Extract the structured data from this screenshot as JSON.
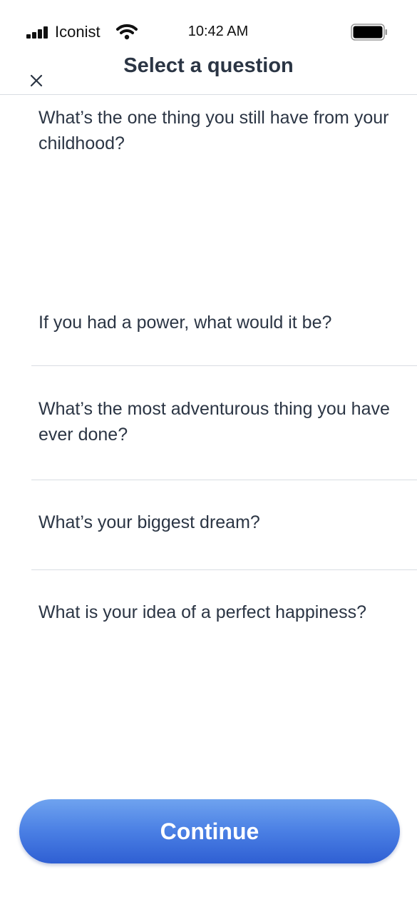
{
  "status_bar": {
    "carrier": "Iconist",
    "time": "10:42 AM",
    "signal_icon": "cellular-signal-icon",
    "wifi_icon": "wifi-icon",
    "battery_icon": "battery-icon"
  },
  "header": {
    "title": "Select a question",
    "close_icon": "close-icon"
  },
  "questions": [
    {
      "text": "What’s the one thing you still have from your childhood?"
    },
    {
      "text": "If you had a power, what would it be?"
    },
    {
      "text": "What’s the most adventurous thing you have ever done?"
    },
    {
      "text": "What’s your biggest dream?"
    },
    {
      "text": "What is your idea of a perfect happiness?"
    }
  ],
  "footer": {
    "continue_label": "Continue"
  },
  "colors": {
    "text": "#2b3544",
    "divider": "#d9dde3",
    "button_top": "#6fa3ef",
    "button_bottom": "#2f5fd3",
    "button_text": "#ffffff"
  }
}
